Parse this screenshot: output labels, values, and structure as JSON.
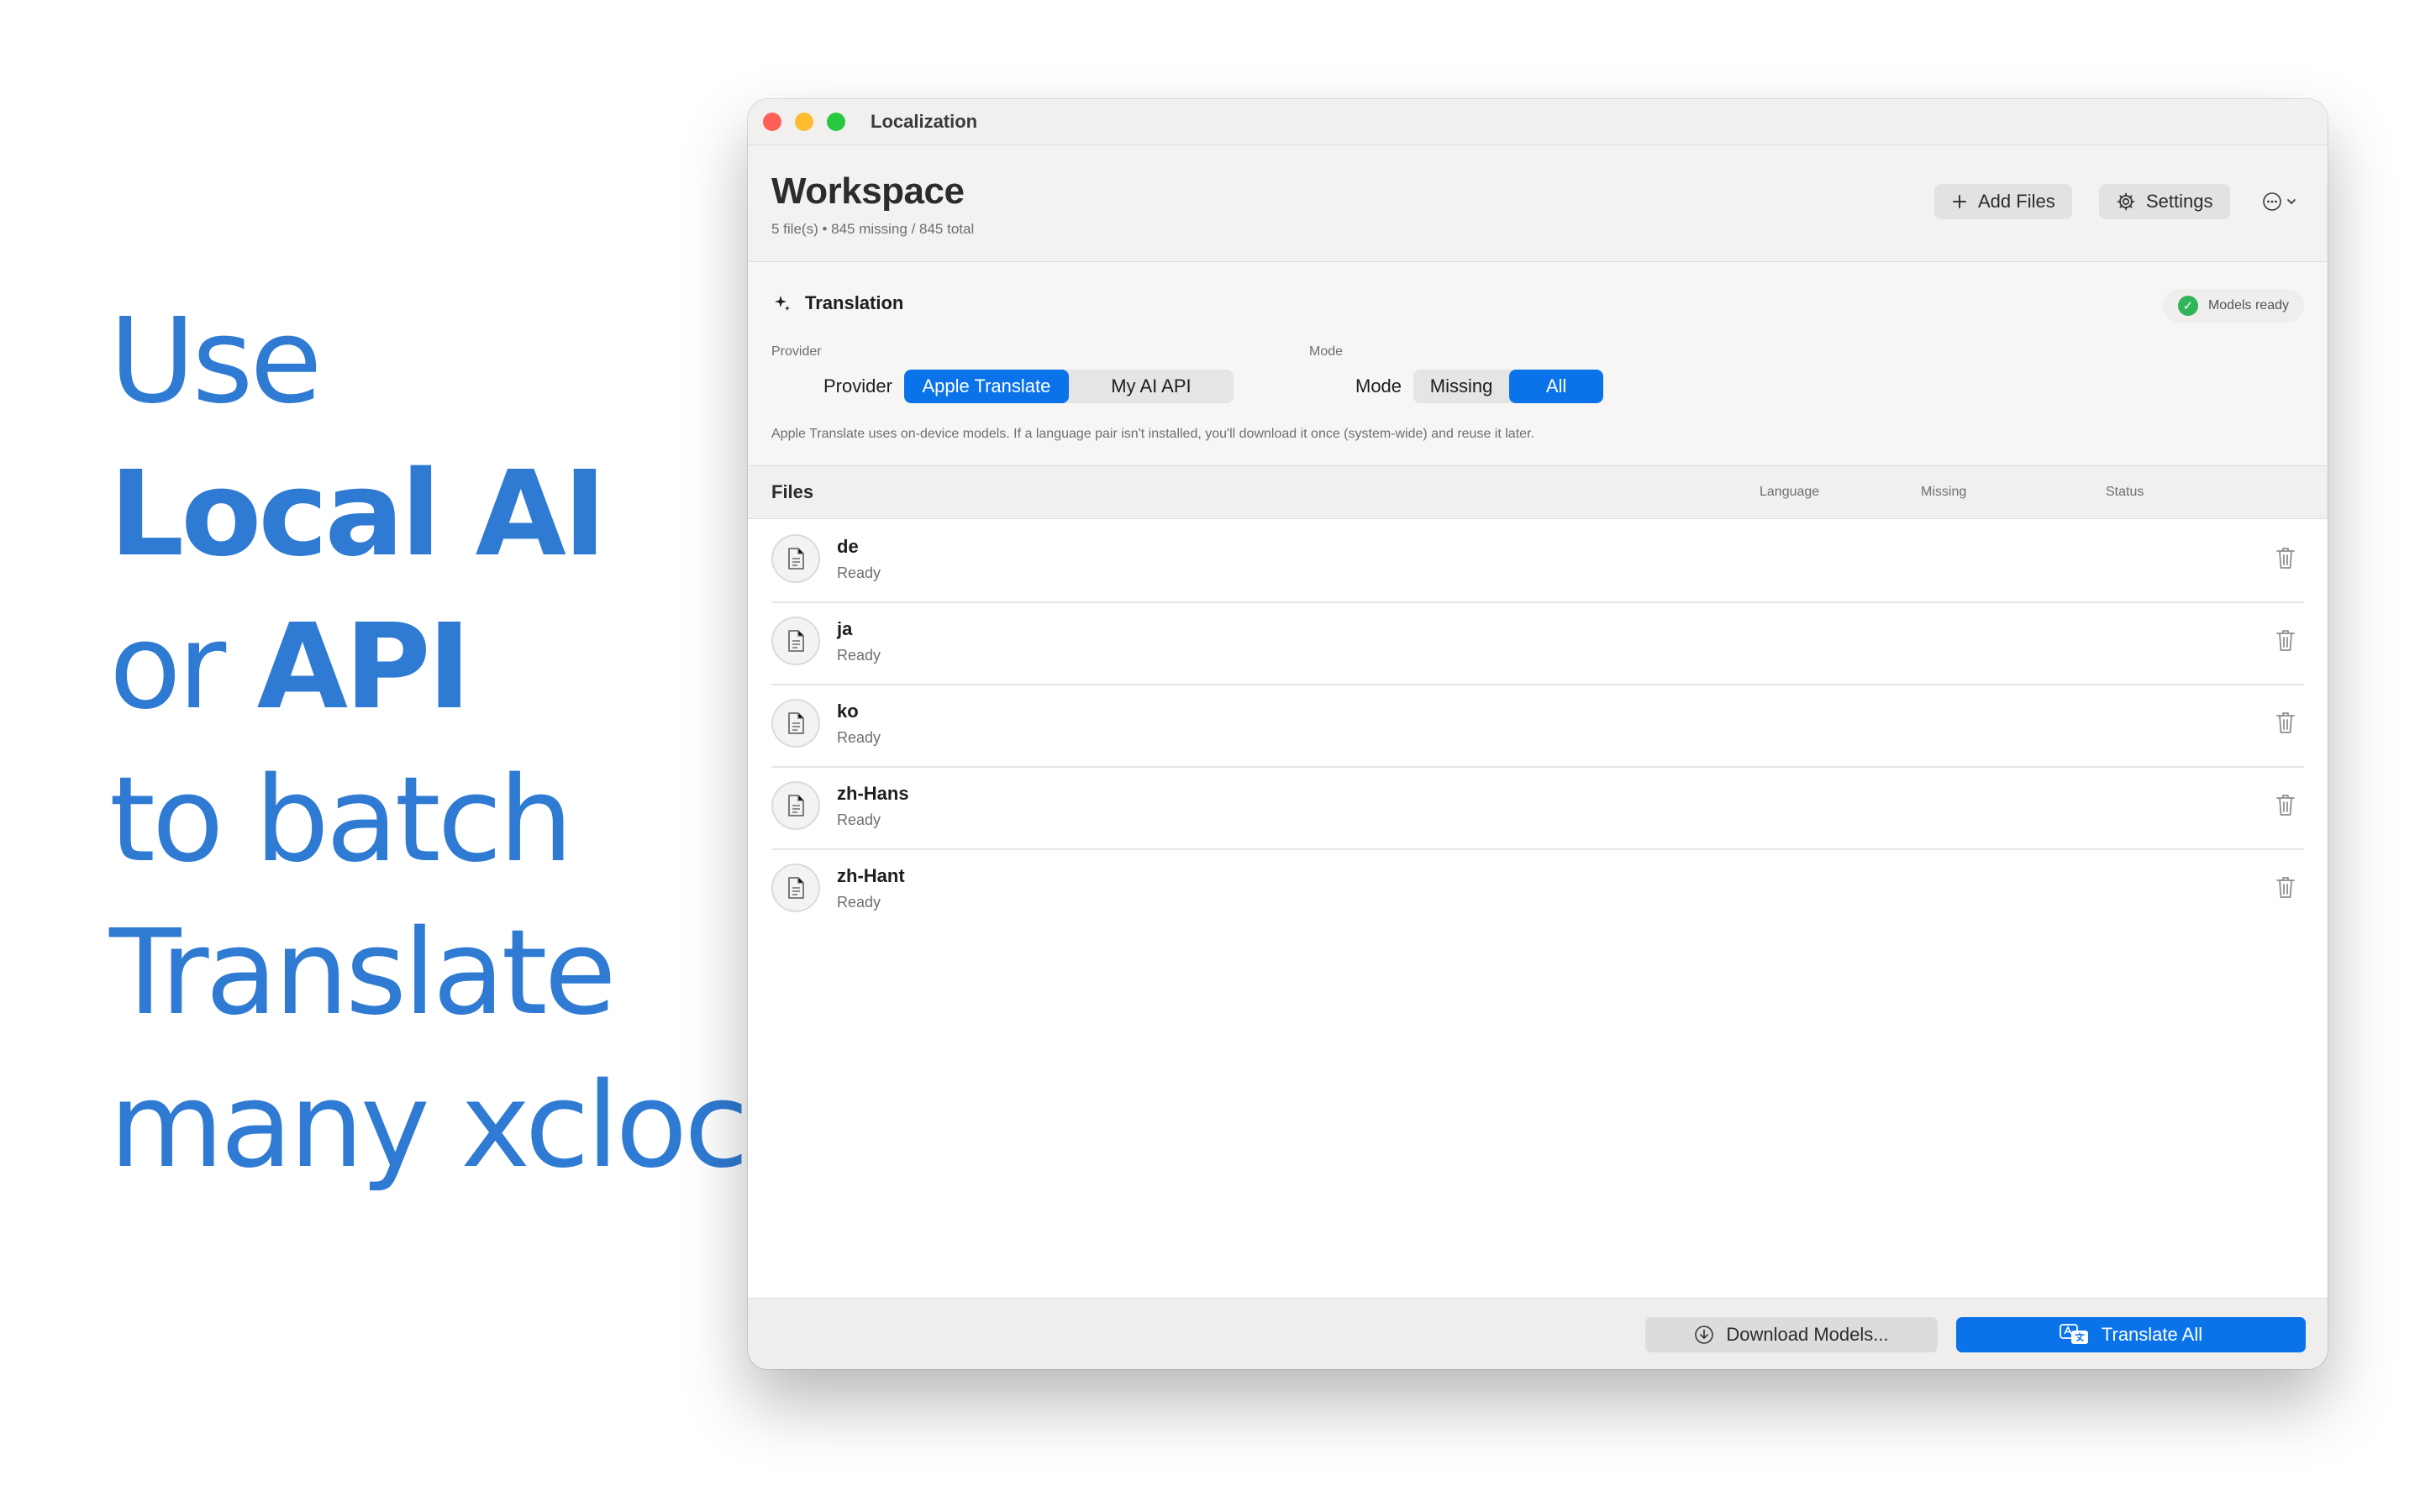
{
  "headline": {
    "line1": "Use",
    "line2": "Local AI",
    "line3_prefix": "or",
    "line3_bold": "API",
    "line4": "to batch",
    "line5": "Translate",
    "line6": "many xcloc"
  },
  "window": {
    "title": "Localization"
  },
  "workspace": {
    "title": "Workspace",
    "subtitle": "5 file(s) • 845 missing / 845 total",
    "add_files_label": "Add Files",
    "settings_label": "Settings"
  },
  "translation": {
    "title": "Translation",
    "models_status": "Models ready",
    "provider_caption": "Provider",
    "provider_label": "Provider",
    "provider_options": [
      "Apple Translate",
      "My AI API"
    ],
    "provider_selected": "Apple Translate",
    "mode_caption": "Mode",
    "mode_label": "Mode",
    "mode_options": [
      "Missing",
      "All"
    ],
    "mode_selected": "All",
    "help_text": "Apple Translate uses on-device models. If a language pair isn't installed, you'll download it once (system-wide) and reuse it later."
  },
  "files": {
    "title": "Files",
    "columns": [
      "Language",
      "Missing",
      "Status"
    ],
    "rows": [
      {
        "name": "de",
        "status": "Ready"
      },
      {
        "name": "ja",
        "status": "Ready"
      },
      {
        "name": "ko",
        "status": "Ready"
      },
      {
        "name": "zh-Hans",
        "status": "Ready"
      },
      {
        "name": "zh-Hant",
        "status": "Ready"
      }
    ]
  },
  "footer": {
    "download_label": "Download Models...",
    "translate_label": "Translate All"
  },
  "colors": {
    "accent": "#0a73ea",
    "headline": "#2f7bd3",
    "ready_badge": "#30b45a"
  }
}
